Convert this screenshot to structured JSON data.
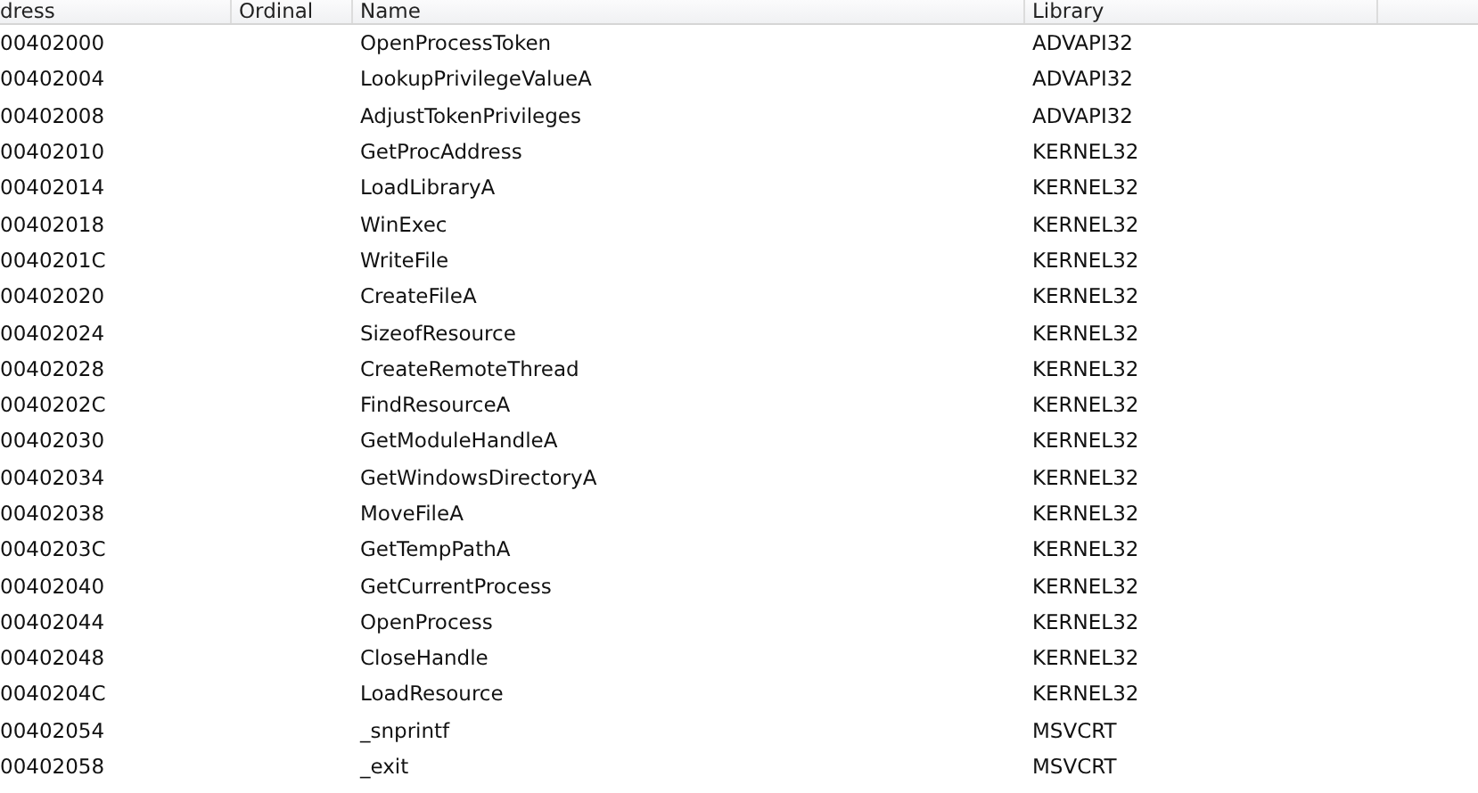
{
  "table": {
    "columns": [
      "dress",
      "Ordinal",
      "Name",
      "Library"
    ],
    "rows": [
      {
        "address": "00402000",
        "name": "OpenProcessToken",
        "library": "ADVAPI32"
      },
      {
        "address": "00402004",
        "name": "LookupPrivilegeValueA",
        "library": "ADVAPI32"
      },
      {
        "address": "00402008",
        "name": "AdjustTokenPrivileges",
        "library": "ADVAPI32"
      },
      {
        "address": "00402010",
        "name": "GetProcAddress",
        "library": "KERNEL32"
      },
      {
        "address": "00402014",
        "name": "LoadLibraryA",
        "library": "KERNEL32"
      },
      {
        "address": "00402018",
        "name": "WinExec",
        "library": "KERNEL32"
      },
      {
        "address": "0040201C",
        "name": "WriteFile",
        "library": "KERNEL32"
      },
      {
        "address": "00402020",
        "name": "CreateFileA",
        "library": "KERNEL32"
      },
      {
        "address": "00402024",
        "name": "SizeofResource",
        "library": "KERNEL32"
      },
      {
        "address": "00402028",
        "name": "CreateRemoteThread",
        "library": "KERNEL32"
      },
      {
        "address": "0040202C",
        "name": "FindResourceA",
        "library": "KERNEL32"
      },
      {
        "address": "00402030",
        "name": "GetModuleHandleA",
        "library": "KERNEL32"
      },
      {
        "address": "00402034",
        "name": "GetWindowsDirectoryA",
        "library": "KERNEL32"
      },
      {
        "address": "00402038",
        "name": "MoveFileA",
        "library": "KERNEL32"
      },
      {
        "address": "0040203C",
        "name": "GetTempPathA",
        "library": "KERNEL32"
      },
      {
        "address": "00402040",
        "name": "GetCurrentProcess",
        "library": "KERNEL32"
      },
      {
        "address": "00402044",
        "name": "OpenProcess",
        "library": "KERNEL32"
      },
      {
        "address": "00402048",
        "name": "CloseHandle",
        "library": "KERNEL32"
      },
      {
        "address": "0040204C",
        "name": "LoadResource",
        "library": "KERNEL32"
      },
      {
        "address": "00402054",
        "name": "_snprintf",
        "library": "MSVCRT"
      },
      {
        "address": "00402058",
        "name": "_exit",
        "library": "MSVCRT"
      }
    ]
  }
}
